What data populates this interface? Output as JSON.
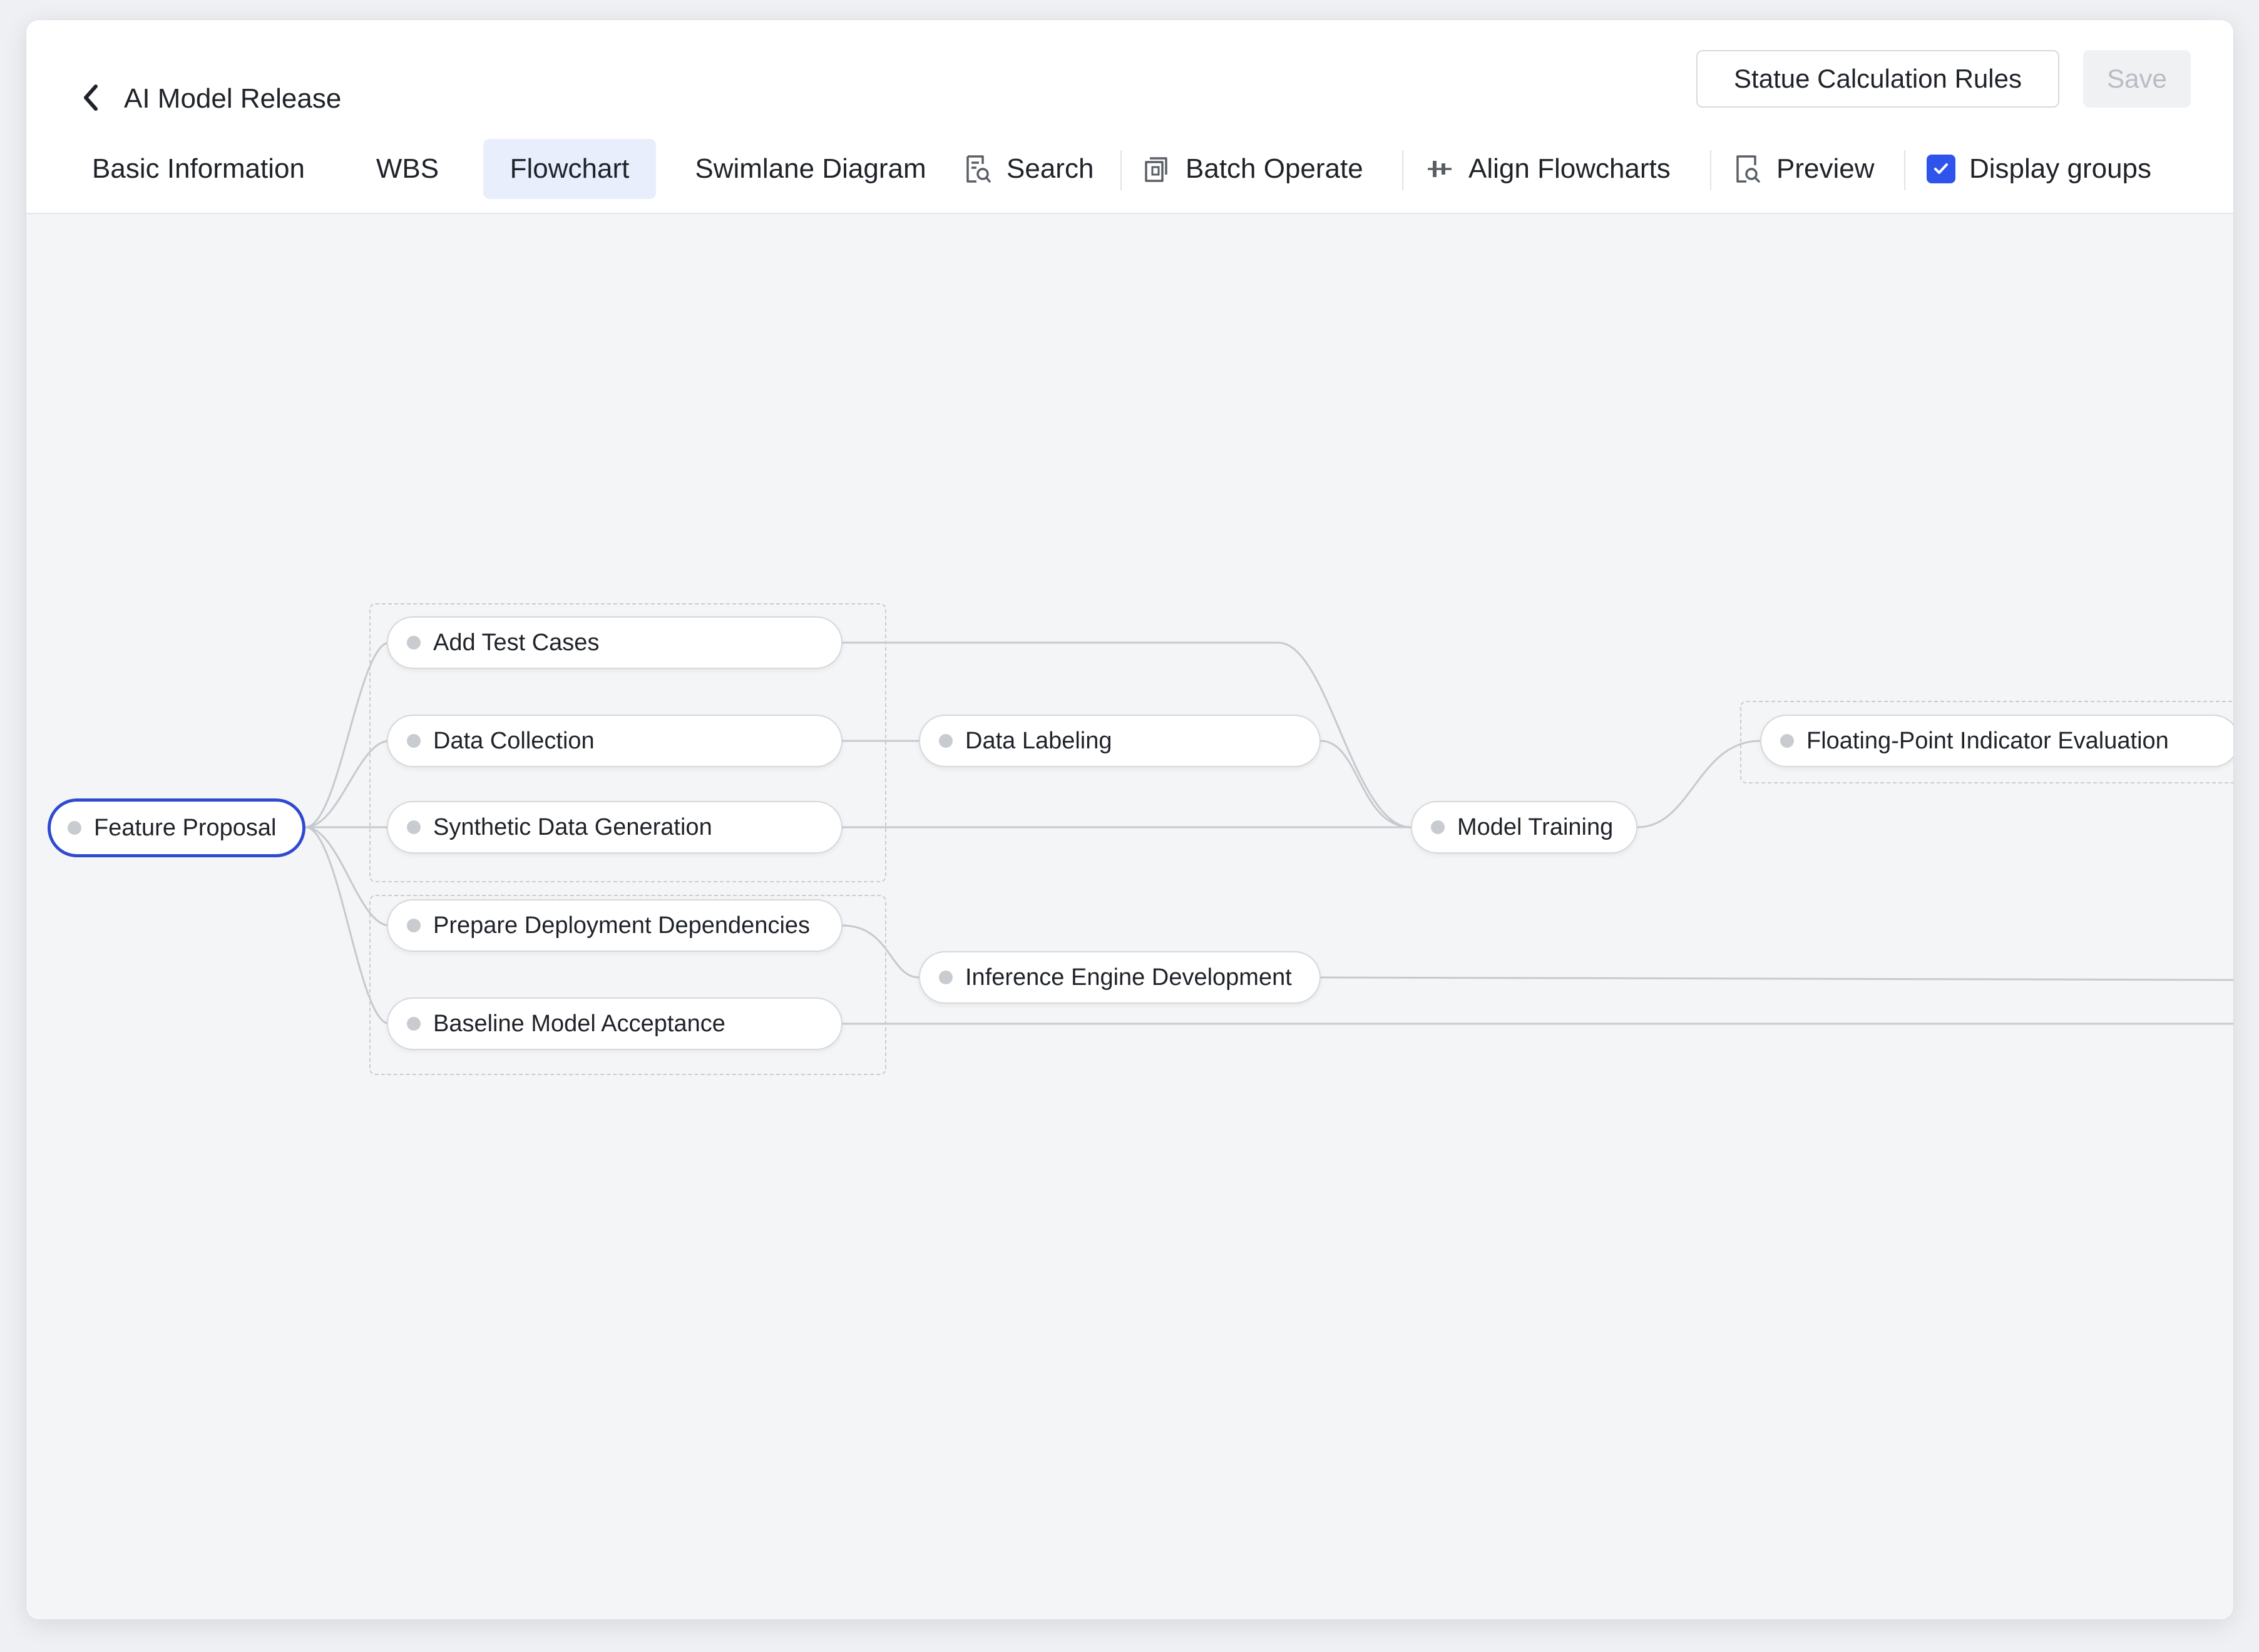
{
  "header": {
    "title": "AI Model Release",
    "buttons": {
      "rules_label": "Statue Calculation Rules",
      "save_label": "Save"
    }
  },
  "tabs": [
    {
      "label": "Basic Information",
      "active": false
    },
    {
      "label": "WBS",
      "active": false
    },
    {
      "label": "Flowchart",
      "active": true
    },
    {
      "label": "Swimlane Diagram",
      "active": false
    }
  ],
  "toolbar": {
    "search_label": "Search",
    "batch_label": "Batch Operate",
    "align_label": "Align Flowcharts",
    "preview_label": "Preview",
    "display_groups_label": "Display groups",
    "display_groups_checked": true
  },
  "flow": {
    "nodes": {
      "feature_proposal": "Feature Proposal",
      "add_test_cases": "Add Test Cases",
      "data_collection": "Data Collection",
      "synthetic_data_generation": "Synthetic Data Generation",
      "prepare_deployment_dependencies": "Prepare Deployment Dependencies",
      "baseline_model_acceptance": "Baseline Model Acceptance",
      "data_labeling": "Data Labeling",
      "inference_engine_development": "Inference Engine Development",
      "model_training": "Model Training",
      "floating_point_indicator_evaluation": "Floating-Point Indicator Evaluation"
    },
    "selected": "feature_proposal",
    "edges": [
      [
        "feature_proposal",
        "add_test_cases"
      ],
      [
        "feature_proposal",
        "data_collection"
      ],
      [
        "feature_proposal",
        "synthetic_data_generation"
      ],
      [
        "feature_proposal",
        "prepare_deployment_dependencies"
      ],
      [
        "feature_proposal",
        "baseline_model_acceptance"
      ],
      [
        "data_collection",
        "data_labeling"
      ],
      [
        "add_test_cases",
        "model_training"
      ],
      [
        "data_labeling",
        "model_training"
      ],
      [
        "synthetic_data_generation",
        "model_training"
      ],
      [
        "model_training",
        "floating_point_indicator_evaluation"
      ],
      [
        "prepare_deployment_dependencies",
        "inference_engine_development"
      ]
    ],
    "colors": {
      "edge": "#c6c9ce",
      "selected_border": "#2f49d1",
      "node_dot": "#c8cbd0",
      "canvas": "#f4f5f7"
    }
  }
}
